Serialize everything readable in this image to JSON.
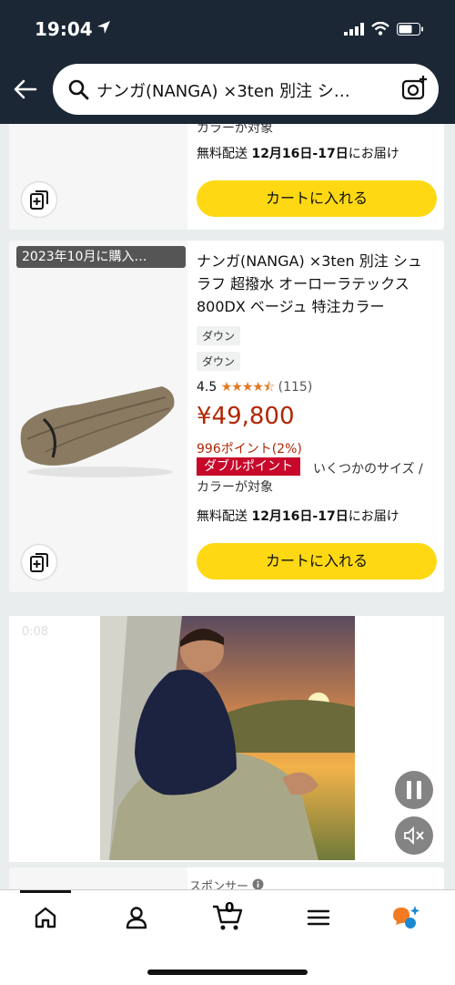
{
  "status": {
    "time": "19:04"
  },
  "search": {
    "query": "ナンガ(NANGA) ×3ten 別注 シ…"
  },
  "card1": {
    "partial_line": "カラーが対象",
    "delivery_prefix": "無料配送 ",
    "delivery_date": "12月16日-17日",
    "delivery_suffix": "にお届け",
    "cart_label": "カートに入れる"
  },
  "card2": {
    "bought_badge": "2023年10月に購入…",
    "title": "ナンガ(NANGA) ×3ten 別注 シュラフ 超撥水 オーローラテックス 800DX ベージュ 特注カラー",
    "tag1": "ダウン",
    "tag2": "ダウン",
    "rating": "4.5",
    "stars": "★★★★⯪",
    "reviews": "(115)",
    "price": "¥49,800",
    "points": "996ポイント(2%)",
    "double_points": "ダブルポイント",
    "size_note_1": "いくつかのサイズ /",
    "size_note_2": "カラーが対象",
    "delivery_prefix": "無料配送 ",
    "delivery_date": "12月16日-17日",
    "delivery_suffix": "にお届け",
    "cart_label": "カートに入れる"
  },
  "video": {
    "timestamp": "0:08"
  },
  "sponsor": {
    "label": "スポンサー"
  },
  "tabs": {
    "cart_count": "0"
  },
  "colors": {
    "header": "#1b2735",
    "cart_button": "#ffd814",
    "price": "#b12704",
    "double_points": "#c7082b"
  }
}
